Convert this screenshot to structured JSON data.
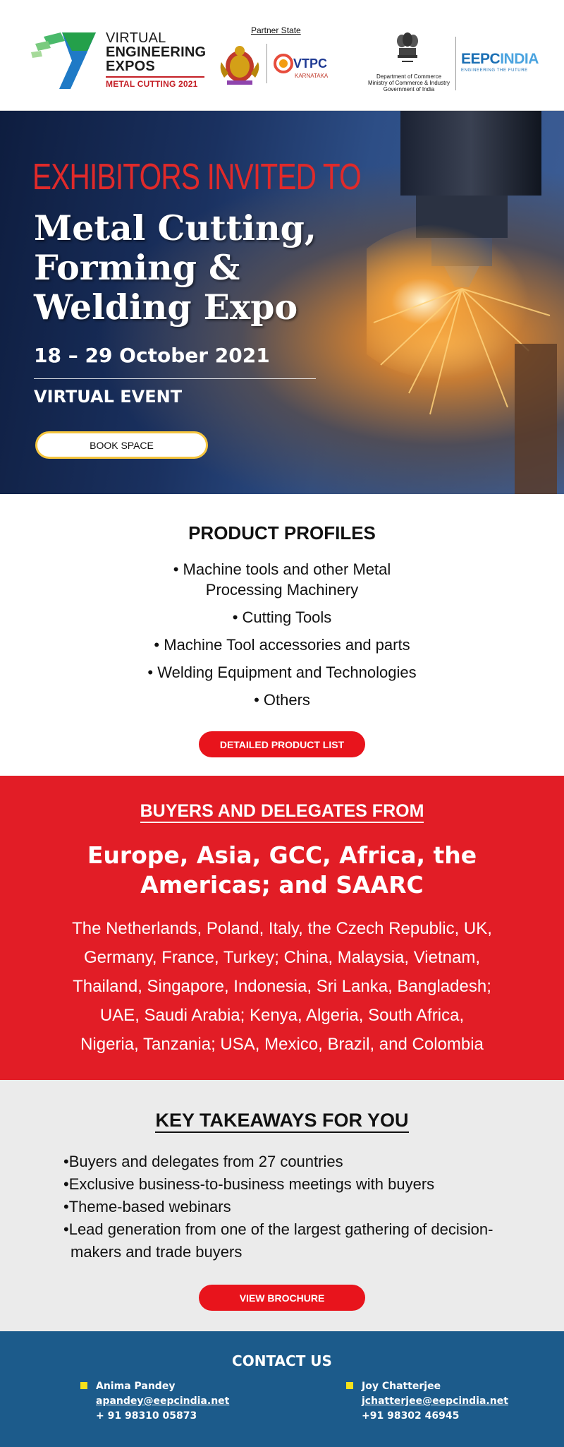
{
  "header": {
    "vee_line1": "VIRTUAL",
    "vee_line2": "ENGINEERING",
    "vee_line3": "EXPOS",
    "vee_tag": "METAL CUTTING 2021",
    "partner_label": "Partner State",
    "vtpc_label": "VTPC",
    "vtpc_sub": "KARNATAKA",
    "dept_line1": "Department of Commerce",
    "dept_line2": "Ministry of Commerce & Industry",
    "dept_line3": "Government of India",
    "eepc_main": "EEPC",
    "eepc_india": "INDIA",
    "eepc_sub": "ENGINEERING THE FUTURE"
  },
  "hero": {
    "eyebrow": "EXHIBITORS INVITED TO",
    "title_line1": "Metal Cutting,",
    "title_line2": "Forming &",
    "title_line3": "Welding Expo",
    "dates": "18 – 29 October 2021",
    "event_type": "VIRTUAL EVENT",
    "book_label": "BOOK SPACE"
  },
  "products": {
    "heading": "PRODUCT PROFILES",
    "items": [
      {
        "line1": "• Machine tools and other Metal",
        "line2": "Processing Machinery"
      },
      {
        "line1": "• Cutting Tools",
        "line2": ""
      },
      {
        "line1": "• Machine Tool accessories and parts",
        "line2": ""
      },
      {
        "line1": "• Welding Equipment and Technologies",
        "line2": ""
      },
      {
        "line1": "• Others",
        "line2": ""
      }
    ],
    "button_label": "DETAILED PRODUCT  LIST"
  },
  "buyers": {
    "heading": "BUYERS AND DELEGATES FROM",
    "regions_line1": "Europe, Asia, GCC, Africa, the",
    "regions_line2": "Americas;  and SAARC",
    "countries_lines": [
      "The Netherlands, Poland, Italy, the Czech Republic, UK,",
      "Germany, France, Turkey; China, Malaysia, Vietnam,",
      "Thailand, Singapore, Indonesia, Sri Lanka, Bangladesh;",
      "UAE, Saudi Arabia; Kenya, Algeria, South Africa,",
      "Nigeria, Tanzania; USA, Mexico, Brazil, and Colombia"
    ]
  },
  "takeaways": {
    "heading": "KEY TAKEAWAYS FOR YOU",
    "items": [
      "•Buyers and delegates from 27 countries",
      "•Exclusive business-to-business meetings with buyers",
      "•Theme-based webinars",
      "•Lead generation from one of the largest gathering of decision-makers and trade buyers"
    ],
    "button_label": "VIEW BROCHURE"
  },
  "contact": {
    "heading": "CONTACT US",
    "people": [
      {
        "name": "Anima Pandey",
        "email": "apandey@eepcindia.net",
        "phone": "+ 91 98310 05873"
      },
      {
        "name": "Joy Chatterjee",
        "email": "jchatterjee@eepcindia.net",
        "phone": "+91 98302 46945"
      }
    ],
    "bullet_color": "#f5e11a"
  },
  "colors": {
    "brand_red": "#e21d26",
    "button_red": "#e8141c",
    "contact_blue": "#1c5b8b",
    "eepc_blue": "#1b6fb4",
    "book_border": "#f5c53e"
  }
}
